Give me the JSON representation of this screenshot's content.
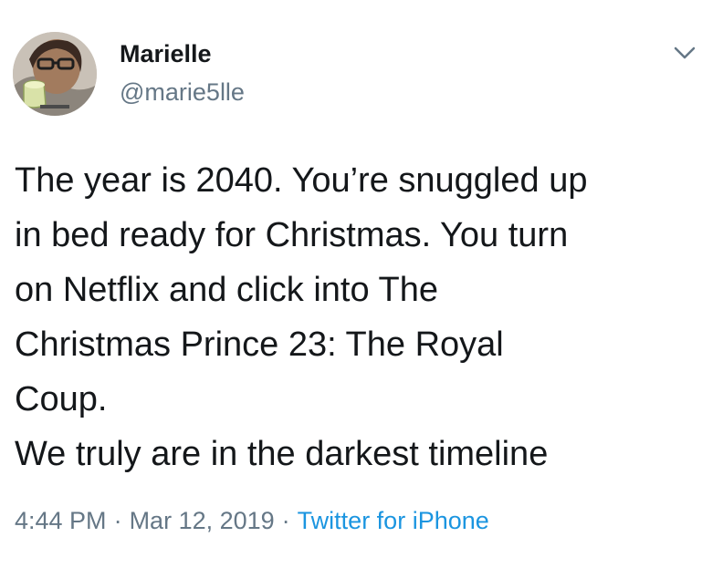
{
  "user": {
    "display_name": "Marielle",
    "handle": "@marie5lle",
    "avatar_icon": "profile-photo"
  },
  "tweet": {
    "text": "The year is 2040. You’re snuggled up\nin bed ready for Christmas. You turn\non Netflix and click into The\nChristmas Prince 23: The Royal\nCoup.\nWe truly are in the darkest timeline",
    "time": "4:44 PM",
    "date": "Mar 12, 2019",
    "separator": "·",
    "source": "Twitter for iPhone"
  },
  "colors": {
    "text": "#14171a",
    "secondary": "#657786",
    "link": "#1b95e0"
  },
  "icons": {
    "menu": "chevron-down-icon"
  }
}
